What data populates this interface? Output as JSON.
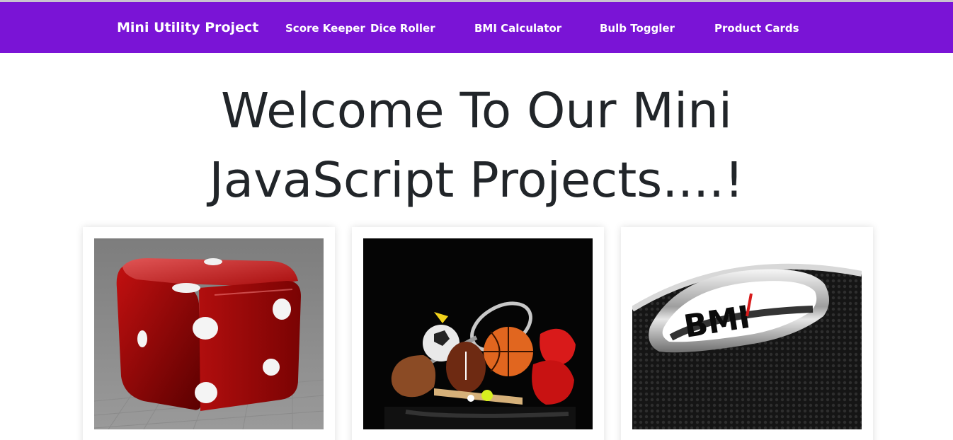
{
  "navbar": {
    "brand": "Mini Utility Project",
    "links": [
      {
        "label": "Score Keeper"
      },
      {
        "label": "Dice Roller"
      },
      {
        "label": "BMI Calculator"
      },
      {
        "label": "Bulb Toggler"
      },
      {
        "label": "Product Cards"
      }
    ],
    "color": "#7a14d6"
  },
  "hero": {
    "line1": "Welcome To Our Mini",
    "line2": "JavaScript Projects....!"
  },
  "cards": [
    {
      "image": "red-dice-image"
    },
    {
      "image": "sports-equipment-image"
    },
    {
      "image": "bmi-scale-image",
      "image_text": "BMI"
    }
  ]
}
